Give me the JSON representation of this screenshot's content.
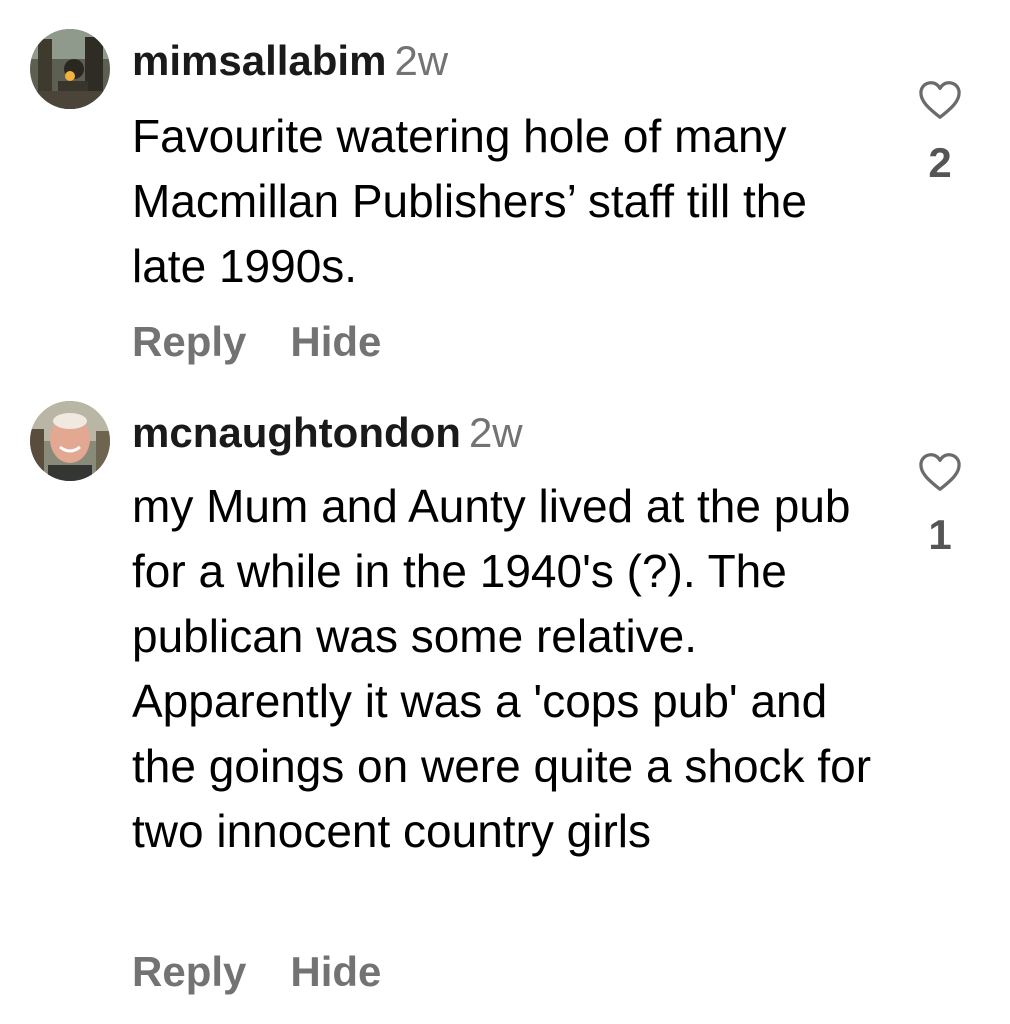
{
  "comments": [
    {
      "username": "mimsallabim",
      "timestamp": "2w",
      "text": "Favourite watering hole of many Macmillan Publishers’ staff till the late 1990s.",
      "likes": "2",
      "reply_label": "Reply",
      "hide_label": "Hide"
    },
    {
      "username": "mcnaughtondon",
      "timestamp": "2w",
      "text": "my Mum and Aunty lived at the pub for a while in the 1940's (?). The publican was some relative. Apparently it was a 'cops pub' and the goings on were quite a shock for two innocent country girls",
      "likes": "1",
      "reply_label": "Reply",
      "hide_label": "Hide"
    }
  ],
  "icons": {
    "like": "heart-outline-icon"
  },
  "colors": {
    "secondary_text": "#737373",
    "like_count": "#555555"
  }
}
